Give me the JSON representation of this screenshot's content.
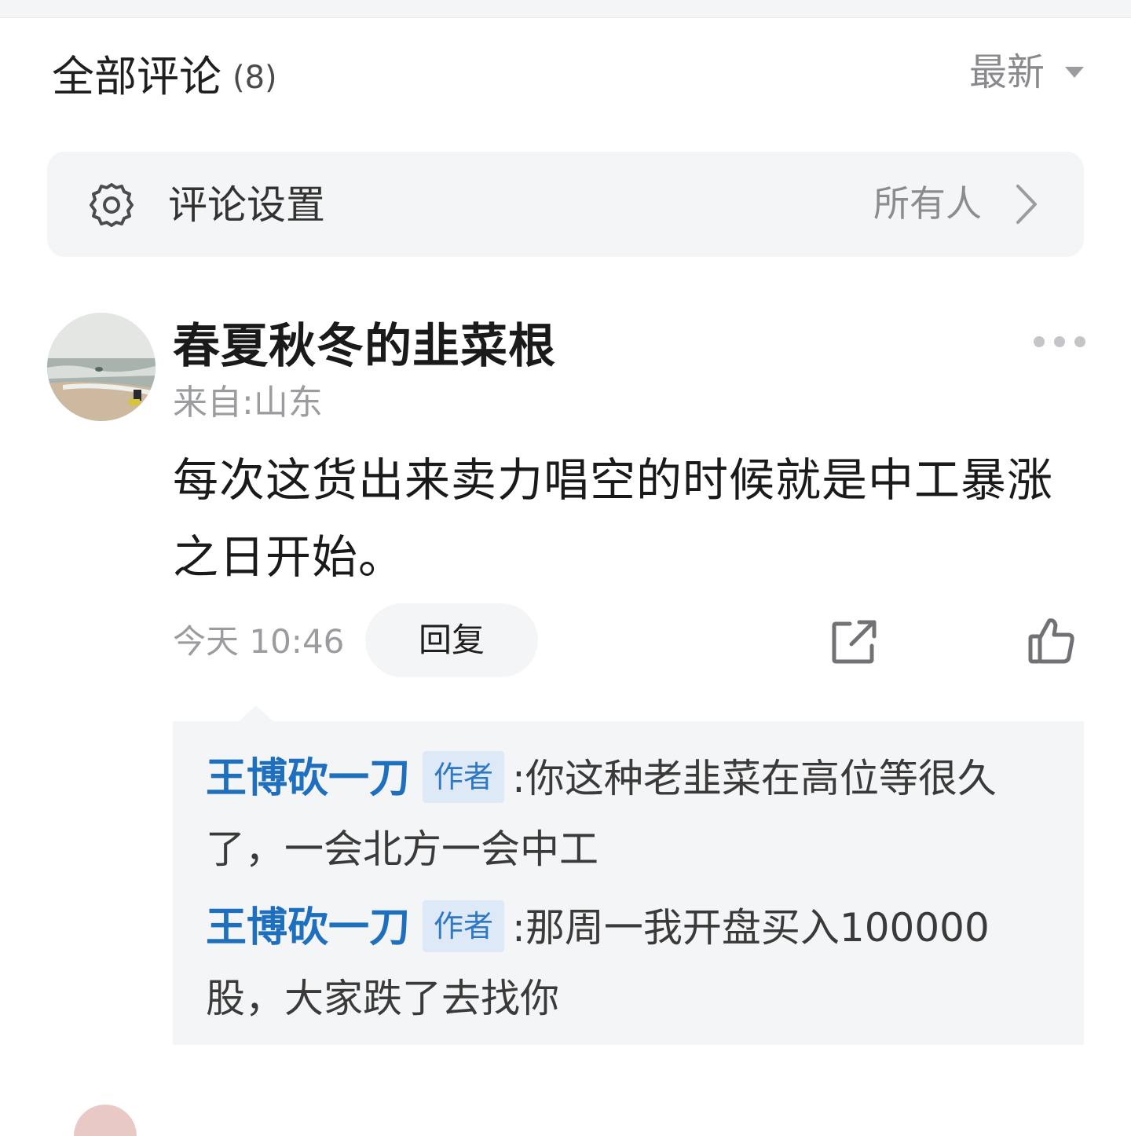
{
  "header": {
    "title": "全部评论",
    "count": "(8)",
    "sort_label": "最新"
  },
  "settings": {
    "title": "评论设置",
    "value": "所有人"
  },
  "comment": {
    "username": "春夏秋冬的韭菜根",
    "location": "来自:山东",
    "content": "每次这货出来卖力唱空的时候就是中工暴涨之日开始。",
    "time": "今天 10:46",
    "reply_label": "回复"
  },
  "replies": [
    {
      "author": "王博砍一刀",
      "tag": "作者",
      "separator": ":",
      "text": "你这种老韭菜在高位等很久了，一会北方一会中工"
    },
    {
      "author": "王博砍一刀",
      "tag": "作者",
      "separator": ":",
      "text": "那周一我开盘买入100000股，大家跌了去找你"
    }
  ]
}
